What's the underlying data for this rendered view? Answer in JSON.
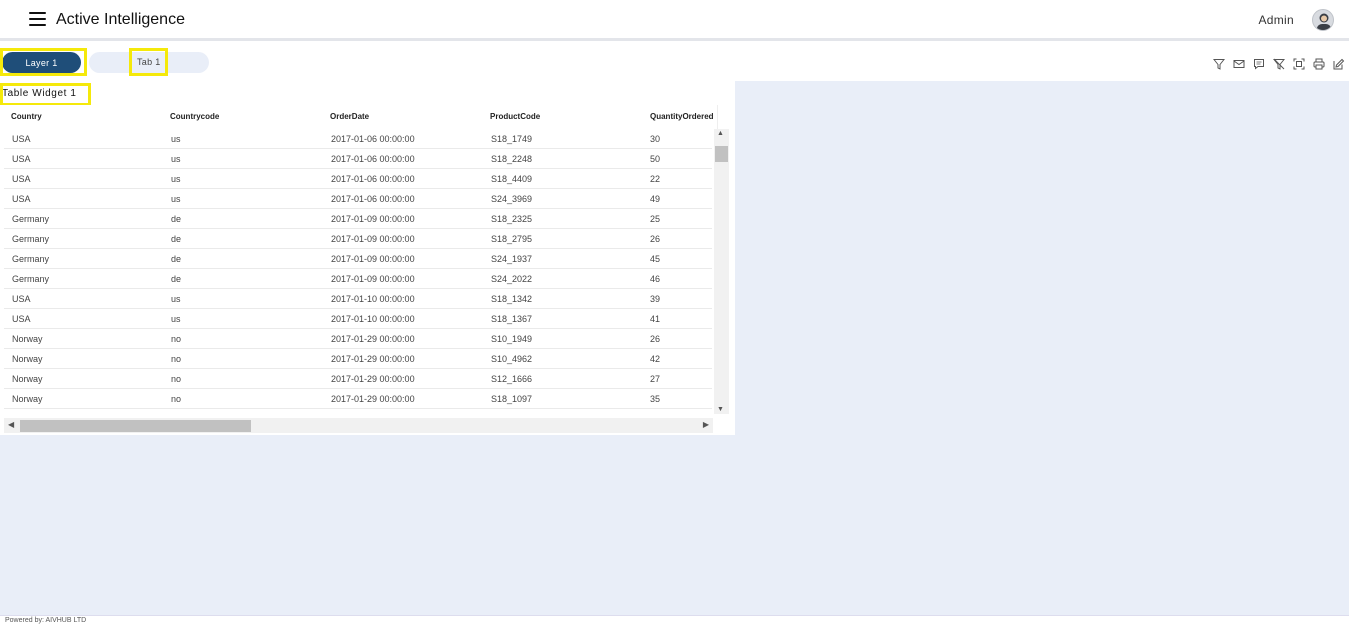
{
  "header": {
    "title": "Active Intelligence",
    "user_name": "Admin"
  },
  "tabs": {
    "layer_label": "Layer 1",
    "tab_label": "Tab 1"
  },
  "widget": {
    "title": "Table Widget 1",
    "columns": [
      "Country",
      "Countrycode",
      "OrderDate",
      "ProductCode",
      "QuantityOrdered"
    ],
    "rows": [
      [
        "USA",
        "us",
        "2017-01-06 00:00:00",
        "S18_1749",
        "30"
      ],
      [
        "USA",
        "us",
        "2017-01-06 00:00:00",
        "S18_2248",
        "50"
      ],
      [
        "USA",
        "us",
        "2017-01-06 00:00:00",
        "S18_4409",
        "22"
      ],
      [
        "USA",
        "us",
        "2017-01-06 00:00:00",
        "S24_3969",
        "49"
      ],
      [
        "Germany",
        "de",
        "2017-01-09 00:00:00",
        "S18_2325",
        "25"
      ],
      [
        "Germany",
        "de",
        "2017-01-09 00:00:00",
        "S18_2795",
        "26"
      ],
      [
        "Germany",
        "de",
        "2017-01-09 00:00:00",
        "S24_1937",
        "45"
      ],
      [
        "Germany",
        "de",
        "2017-01-09 00:00:00",
        "S24_2022",
        "46"
      ],
      [
        "USA",
        "us",
        "2017-01-10 00:00:00",
        "S18_1342",
        "39"
      ],
      [
        "USA",
        "us",
        "2017-01-10 00:00:00",
        "S18_1367",
        "41"
      ],
      [
        "Norway",
        "no",
        "2017-01-29 00:00:00",
        "S10_1949",
        "26"
      ],
      [
        "Norway",
        "no",
        "2017-01-29 00:00:00",
        "S10_4962",
        "42"
      ],
      [
        "Norway",
        "no",
        "2017-01-29 00:00:00",
        "S12_1666",
        "27"
      ],
      [
        "Norway",
        "no",
        "2017-01-29 00:00:00",
        "S18_1097",
        "35"
      ]
    ]
  },
  "toolbar": {
    "icons": [
      "filter-icon",
      "email-icon",
      "comment-icon",
      "clear-filter-icon",
      "screenshot-icon",
      "print-icon",
      "edit-icon"
    ]
  },
  "footer": {
    "text": "Powered by: AIVHUB LTD"
  },
  "colors": {
    "layer_button": "#1f4e79",
    "canvas": "#e9eef8",
    "highlight": "#f5e90a"
  }
}
